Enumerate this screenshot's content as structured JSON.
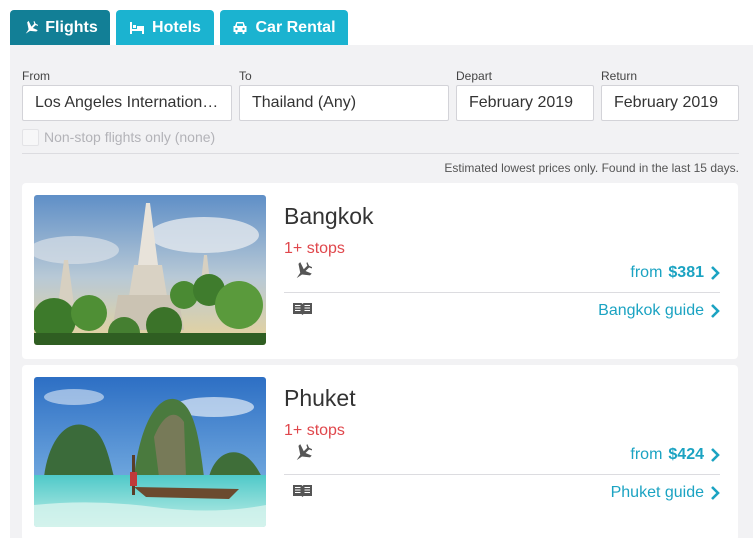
{
  "tabs": [
    {
      "label": "Flights",
      "icon": "plane-icon",
      "active": true
    },
    {
      "label": "Hotels",
      "icon": "bed-icon",
      "active": false
    },
    {
      "label": "Car Rental",
      "icon": "car-icon",
      "active": false
    }
  ],
  "search": {
    "from_label": "From",
    "from_value": "Los Angeles International (LAX)",
    "to_label": "To",
    "to_value": "Thailand (Any)",
    "depart_label": "Depart",
    "depart_value": "February 2019",
    "return_label": "Return",
    "return_value": "February 2019",
    "nonstop_label": "Non-stop flights only (none)"
  },
  "note": "Estimated lowest prices only. Found in the last 15 days.",
  "results": [
    {
      "city": "Bangkok",
      "stops": "1+ stops",
      "price_prefix": "from",
      "price": "$381",
      "guide": "Bangkok guide"
    },
    {
      "city": "Phuket",
      "stops": "1+ stops",
      "price_prefix": "from",
      "price": "$424",
      "guide": "Phuket guide"
    }
  ],
  "colors": {
    "tab": "#1bb3d0",
    "tab_active": "#127f96",
    "link": "#1ba3c2",
    "stops": "#e0474c",
    "panel": "#f2f2f4"
  }
}
